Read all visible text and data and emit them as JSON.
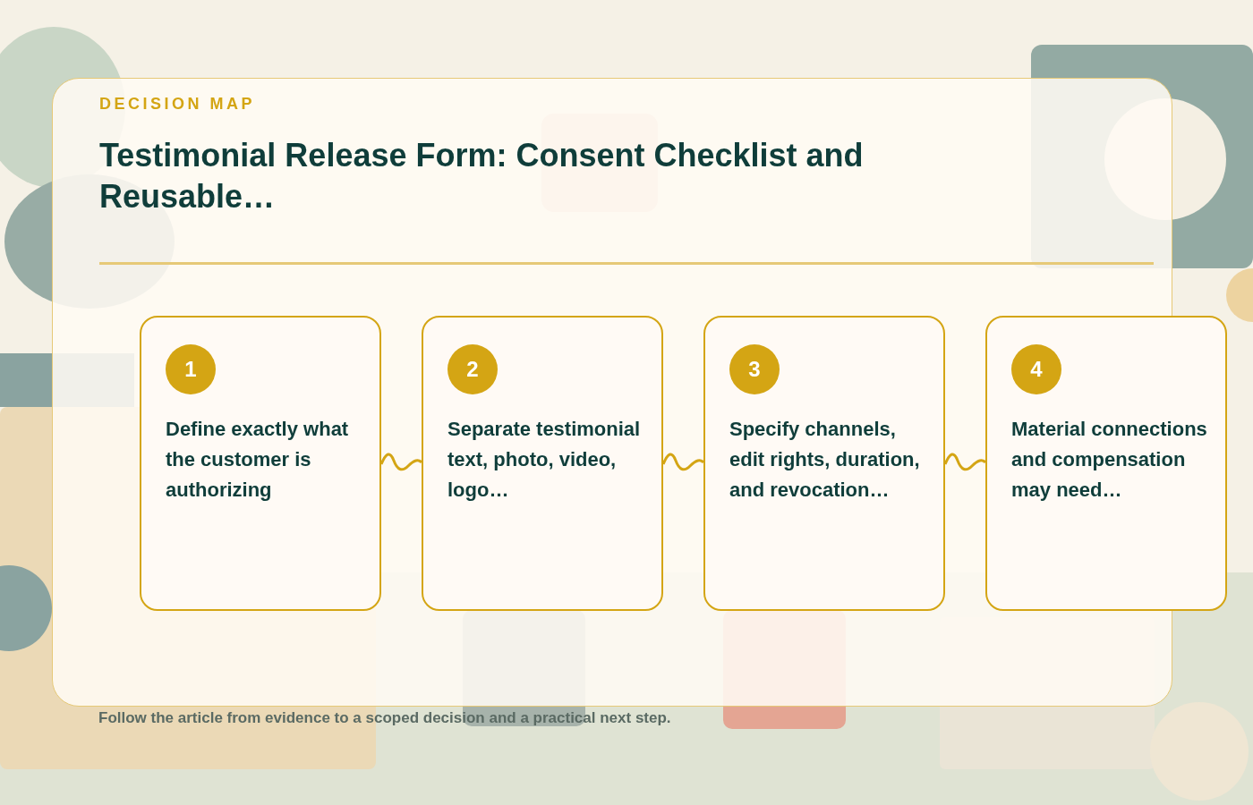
{
  "eyebrow": "DECISION MAP",
  "title": "Testimonial Release Form: Consent Checklist and Reusable…",
  "steps": [
    {
      "number": "1",
      "text": "Define exactly what the customer is authorizing"
    },
    {
      "number": "2",
      "text": "Separate testimonial text, photo, video, logo…"
    },
    {
      "number": "3",
      "text": "Specify channels, edit rights, duration, and revocation…"
    },
    {
      "number": "4",
      "text": "Material connections and compensation may need…"
    }
  ],
  "caption": "Follow the article from evidence to a scoped decision and a practical next step."
}
